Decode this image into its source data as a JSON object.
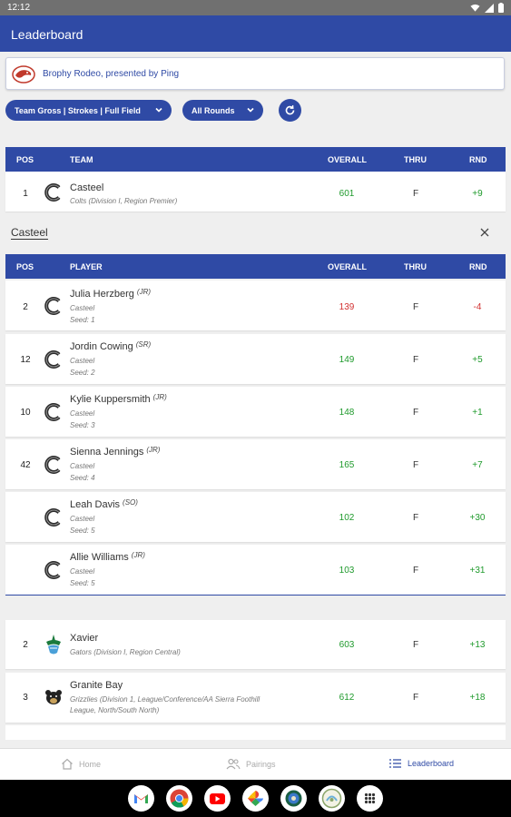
{
  "status_bar": {
    "time": "12:12"
  },
  "app_bar": {
    "title": "Leaderboard"
  },
  "event": {
    "name": "Brophy Rodeo, presented by Ping"
  },
  "filters": {
    "scoring": "Team Gross | Strokes | Full Field",
    "rounds": "All Rounds"
  },
  "team_table": {
    "headers": {
      "pos": "POS",
      "team": "TEAM",
      "overall": "OVERALL",
      "thru": "THRU",
      "rnd": "RND"
    },
    "selected": {
      "pos": "1",
      "name": "Casteel",
      "sub": "Colts (Division I, Region Premier)",
      "overall": "601",
      "thru": "F",
      "rnd": "+9"
    }
  },
  "expanded": {
    "title": "Casteel",
    "headers": {
      "pos": "POS",
      "player": "PLAYER",
      "overall": "OVERALL",
      "thru": "THRU",
      "rnd": "RND"
    },
    "players": [
      {
        "pos": "2",
        "name": "Julia Herzberg",
        "grade": "(JR)",
        "team": "Casteel",
        "seed": "Seed: 1",
        "overall": "139",
        "thru": "F",
        "rnd": "-4"
      },
      {
        "pos": "12",
        "name": "Jordin Cowing",
        "grade": "(SR)",
        "team": "Casteel",
        "seed": "Seed: 2",
        "overall": "149",
        "thru": "F",
        "rnd": "+5"
      },
      {
        "pos": "10",
        "name": "Kylie Kuppersmith",
        "grade": "(JR)",
        "team": "Casteel",
        "seed": "Seed: 3",
        "overall": "148",
        "thru": "F",
        "rnd": "+1"
      },
      {
        "pos": "42",
        "name": "Sienna Jennings",
        "grade": "(JR)",
        "team": "Casteel",
        "seed": "Seed: 4",
        "overall": "165",
        "thru": "F",
        "rnd": "+7"
      },
      {
        "pos": "",
        "name": "Leah Davis",
        "grade": "(SO)",
        "team": "Casteel",
        "seed": "Seed: 5",
        "overall": "102",
        "thru": "F",
        "rnd": "+30"
      },
      {
        "pos": "",
        "name": "Allie Williams",
        "grade": "(JR)",
        "team": "Casteel",
        "seed": "Seed: 5",
        "overall": "103",
        "thru": "F",
        "rnd": "+31"
      }
    ]
  },
  "other_teams": [
    {
      "pos": "2",
      "name": "Xavier",
      "sub": "Gators (Division I, Region Central)",
      "overall": "603",
      "thru": "F",
      "rnd": "+13"
    },
    {
      "pos": "3",
      "name": "Granite Bay",
      "sub1": "Grizzlies (Division 1, League/Conference/AA Sierra Foothill",
      "sub2": "League, North/South North)",
      "overall": "612",
      "thru": "F",
      "rnd": "+18"
    }
  ],
  "bottom_nav": {
    "home": "Home",
    "pairings": "Pairings",
    "leaderboard": "Leaderboard"
  },
  "dock_apps": [
    "gmail-icon",
    "chrome-icon",
    "youtube-icon",
    "photos-icon",
    "app-icon-1",
    "app-icon-2",
    "apps-grid-icon"
  ],
  "colors": {
    "primary": "#2f4aa5",
    "positive": "#1f9a2c",
    "negative": "#d23030"
  }
}
